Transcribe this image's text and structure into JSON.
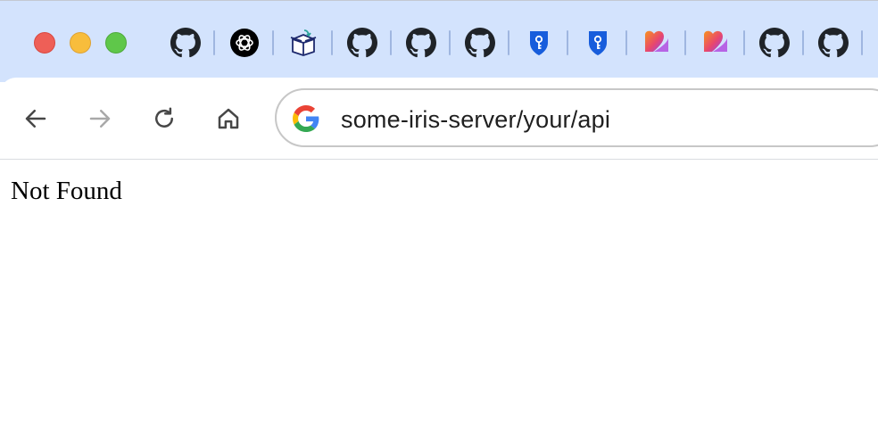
{
  "window": {
    "traffic_lights": [
      "close",
      "minimize",
      "zoom"
    ]
  },
  "tabs": [
    {
      "icon": "github-icon"
    },
    {
      "icon": "openai-icon"
    },
    {
      "icon": "package-box-icon"
    },
    {
      "icon": "github-icon"
    },
    {
      "icon": "github-icon"
    },
    {
      "icon": "github-icon"
    },
    {
      "icon": "bitwarden-shield-icon"
    },
    {
      "icon": "bitwarden-shield-icon"
    },
    {
      "icon": "heart-app-icon"
    },
    {
      "icon": "heart-app-icon"
    },
    {
      "icon": "github-icon"
    },
    {
      "icon": "github-icon"
    }
  ],
  "toolbar": {
    "back": "back-arrow-icon",
    "forward": "forward-arrow-icon",
    "reload": "reload-icon",
    "home": "home-icon",
    "url": "some-iris-server/your/api"
  },
  "page": {
    "text": "Not Found"
  },
  "colors": {
    "tabstrip_bg": "#d3e3fd",
    "close": "#ee5f57",
    "minimize": "#f8bd3c",
    "zoom": "#5fc74a",
    "bitwarden": "#175ddc",
    "heart_start": "#f7931e",
    "heart_end": "#8e44ef"
  }
}
